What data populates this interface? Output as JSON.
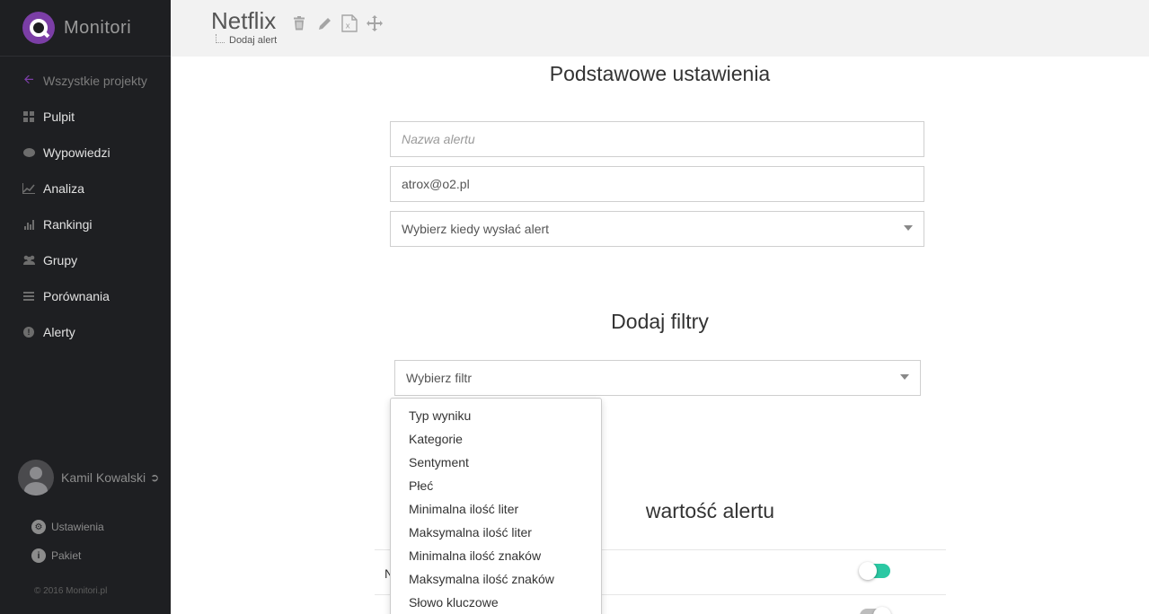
{
  "sidebar": {
    "logo_text": "Monitori",
    "items": [
      {
        "label": "Wszystkie projekty",
        "icon": "arrow-left-icon"
      },
      {
        "label": "Pulpit",
        "icon": "grid-icon"
      },
      {
        "label": "Wypowiedzi",
        "icon": "comments-icon"
      },
      {
        "label": "Analiza",
        "icon": "line-chart-icon"
      },
      {
        "label": "Rankingi",
        "icon": "bar-chart-icon"
      },
      {
        "label": "Grupy",
        "icon": "users-icon"
      },
      {
        "label": "Porównania",
        "icon": "list-icon"
      },
      {
        "label": "Alerty",
        "icon": "exclamation-icon"
      }
    ],
    "user_name": "Kamil Kowalski",
    "settings_label": "Ustawienia",
    "package_label": "Pakiet",
    "copyright": "© 2016 Monitori.pl"
  },
  "header": {
    "project_title": "Netflix",
    "breadcrumb": "Dodaj alert"
  },
  "basic": {
    "title": "Podstawowe ustawienia",
    "name_placeholder": "Nazwa alertu",
    "email_value": "atrox@o2.pl",
    "schedule_placeholder": "Wybierz kiedy wysłać alert"
  },
  "filters": {
    "title": "Dodaj filtry",
    "select_placeholder": "Wybierz filtr",
    "options": [
      "Typ wyniku",
      "Kategorie",
      "Sentyment",
      "Płeć",
      "Minimalna ilość liter",
      "Maksymalna ilość liter",
      "Minimalna ilość znaków",
      "Maksymalna ilość znaków",
      "Słowo kluczowe"
    ]
  },
  "content": {
    "title_visible": "wartość alertu",
    "row1_label_visible": "N",
    "colors": {
      "toggle_on": "#2bc8a3",
      "accent": "#7b3ea6"
    }
  }
}
